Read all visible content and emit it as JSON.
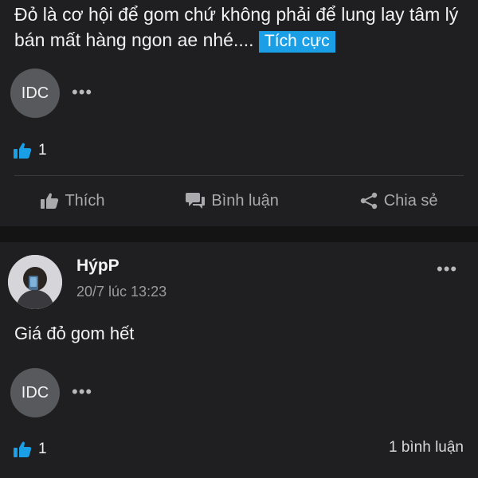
{
  "post1": {
    "text": "Đỏ là cơ hội để gom chứ không phải để lung lay tâm lý bán mất hàng ngon ae nhé....",
    "tag": "Tích cực",
    "avatar_label": "IDC",
    "more_icon": "more-dots-icon",
    "like_count": "1",
    "actions": {
      "like": "Thích",
      "comment": "Bình luận",
      "share": "Chia sẻ"
    }
  },
  "post2": {
    "author": "HýpP",
    "time": "20/7 lúc 13:23",
    "text": "Giá đỏ gom hết",
    "avatar_label": "IDC",
    "like_count": "1",
    "comment_count": "1 bình luận"
  },
  "colors": {
    "background": "#1f1f21",
    "accent_blue": "#1a9fe6",
    "tag_bg": "#1a9fe6"
  }
}
